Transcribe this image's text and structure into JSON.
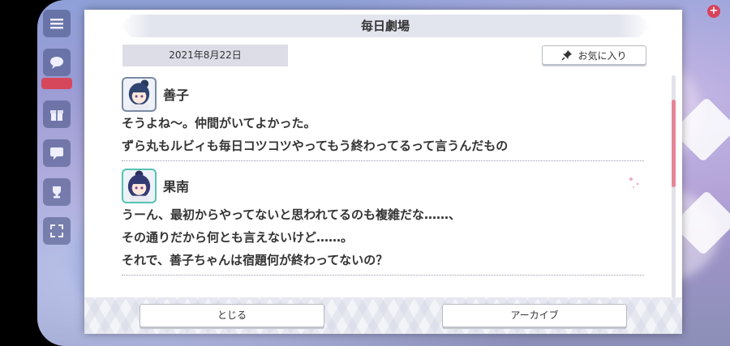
{
  "dialog": {
    "title": "毎日劇場",
    "date": "2021年8月22日",
    "favorite_label": "お気に入り",
    "close_label": "とじる",
    "archive_label": "アーカイブ"
  },
  "entries": [
    {
      "speaker": "善子",
      "lines": [
        "そうよね～。仲間がいてよかった。",
        "ずら丸もルビィも毎日コツコツやってもう終わってるって言うんだもの"
      ]
    },
    {
      "speaker": "果南",
      "lines": [
        "うーん、最初からやってないと思われてるのも複雑だな……、",
        "その通りだから何とも言えないけど……。",
        "それで、善子ちゃんは宿題何が終わってないの？"
      ]
    }
  ],
  "scroll_position": 0.18,
  "colors": {
    "scroll_thumb": "#e58597",
    "kanan_accent": "#54c3b3",
    "badge": "#d9415a"
  },
  "icons": [
    "menu-icon",
    "speech-icon",
    "gift-icon",
    "chat-icon",
    "trophy-icon",
    "fullscreen-icon",
    "pin-icon",
    "plus-icon"
  ]
}
